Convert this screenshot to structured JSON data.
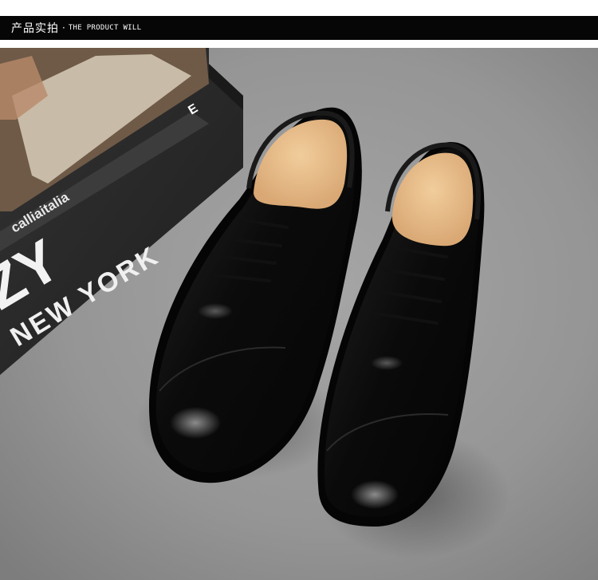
{
  "banner": {
    "title_cn": "产品实拍",
    "separator": "·",
    "title_en": "THE PRODUCT WILL"
  },
  "photo": {
    "subject": "pair of black leather cap-toe derby shoes",
    "book_texts": {
      "spine_brand": "calliaitalia",
      "cover_big": "ZY",
      "cover_city": "NEW YORK",
      "spine_letter": "E"
    },
    "colors": {
      "background": "#9a9a9a",
      "leather": "#0d0d0d",
      "insole": "#e8bf8c",
      "book": "#2b2b2b"
    }
  }
}
